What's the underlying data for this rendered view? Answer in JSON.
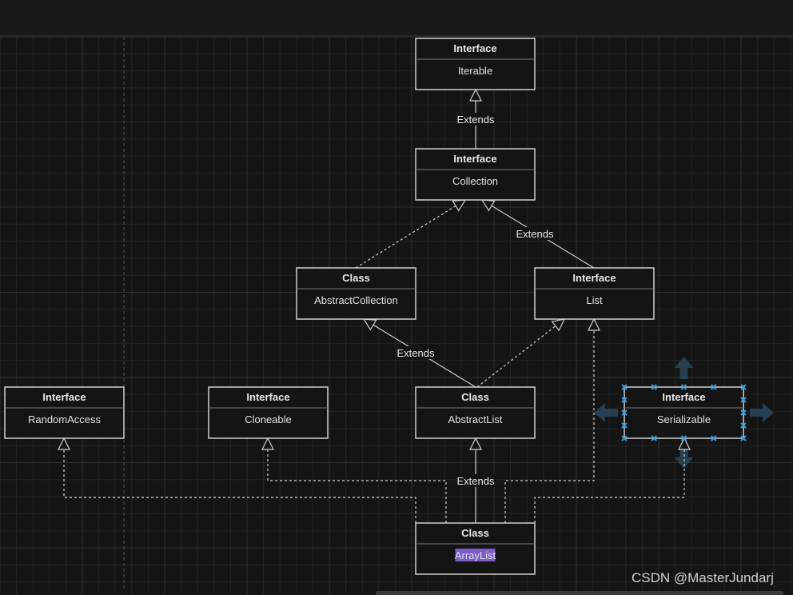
{
  "diagram": {
    "nodes": [
      {
        "id": "iterable",
        "stereotype": "Interface",
        "name": "Iterable"
      },
      {
        "id": "collection",
        "stereotype": "Interface",
        "name": "Collection"
      },
      {
        "id": "abstractcollection",
        "stereotype": "Class",
        "name": "AbstractCollection"
      },
      {
        "id": "list",
        "stereotype": "Interface",
        "name": "List"
      },
      {
        "id": "randomaccess",
        "stereotype": "Interface",
        "name": "RandomAccess"
      },
      {
        "id": "cloneable",
        "stereotype": "Interface",
        "name": "Cloneable"
      },
      {
        "id": "abstractlist",
        "stereotype": "Class",
        "name": "AbstractList"
      },
      {
        "id": "serializable",
        "stereotype": "Interface",
        "name": "Serializable",
        "selected": true
      },
      {
        "id": "arraylist",
        "stereotype": "Class",
        "name": "ArrayList",
        "highlighted": true
      }
    ],
    "edges": [
      {
        "from": "collection",
        "to": "iterable",
        "style": "solid",
        "label": "Extends"
      },
      {
        "from": "abstractcollection",
        "to": "collection",
        "style": "dashed",
        "label": ""
      },
      {
        "from": "list",
        "to": "collection",
        "style": "solid",
        "label": "Extends"
      },
      {
        "from": "abstractlist",
        "to": "abstractcollection",
        "style": "solid",
        "label": "Extends"
      },
      {
        "from": "abstractlist",
        "to": "list",
        "style": "dashed",
        "label": ""
      },
      {
        "from": "arraylist",
        "to": "abstractlist",
        "style": "solid",
        "label": "Extends"
      },
      {
        "from": "arraylist",
        "to": "list",
        "style": "dashed",
        "label": ""
      },
      {
        "from": "arraylist",
        "to": "randomaccess",
        "style": "dashed",
        "label": ""
      },
      {
        "from": "arraylist",
        "to": "cloneable",
        "style": "dashed",
        "label": ""
      },
      {
        "from": "arraylist",
        "to": "serializable",
        "style": "dashed",
        "label": ""
      }
    ],
    "colors": {
      "background": "#141414",
      "stroke": "#d0d0d0",
      "selection": "#3a9ad9",
      "highlight": "#7b5cc9"
    }
  },
  "watermark": "CSDN @MasterJundarj"
}
